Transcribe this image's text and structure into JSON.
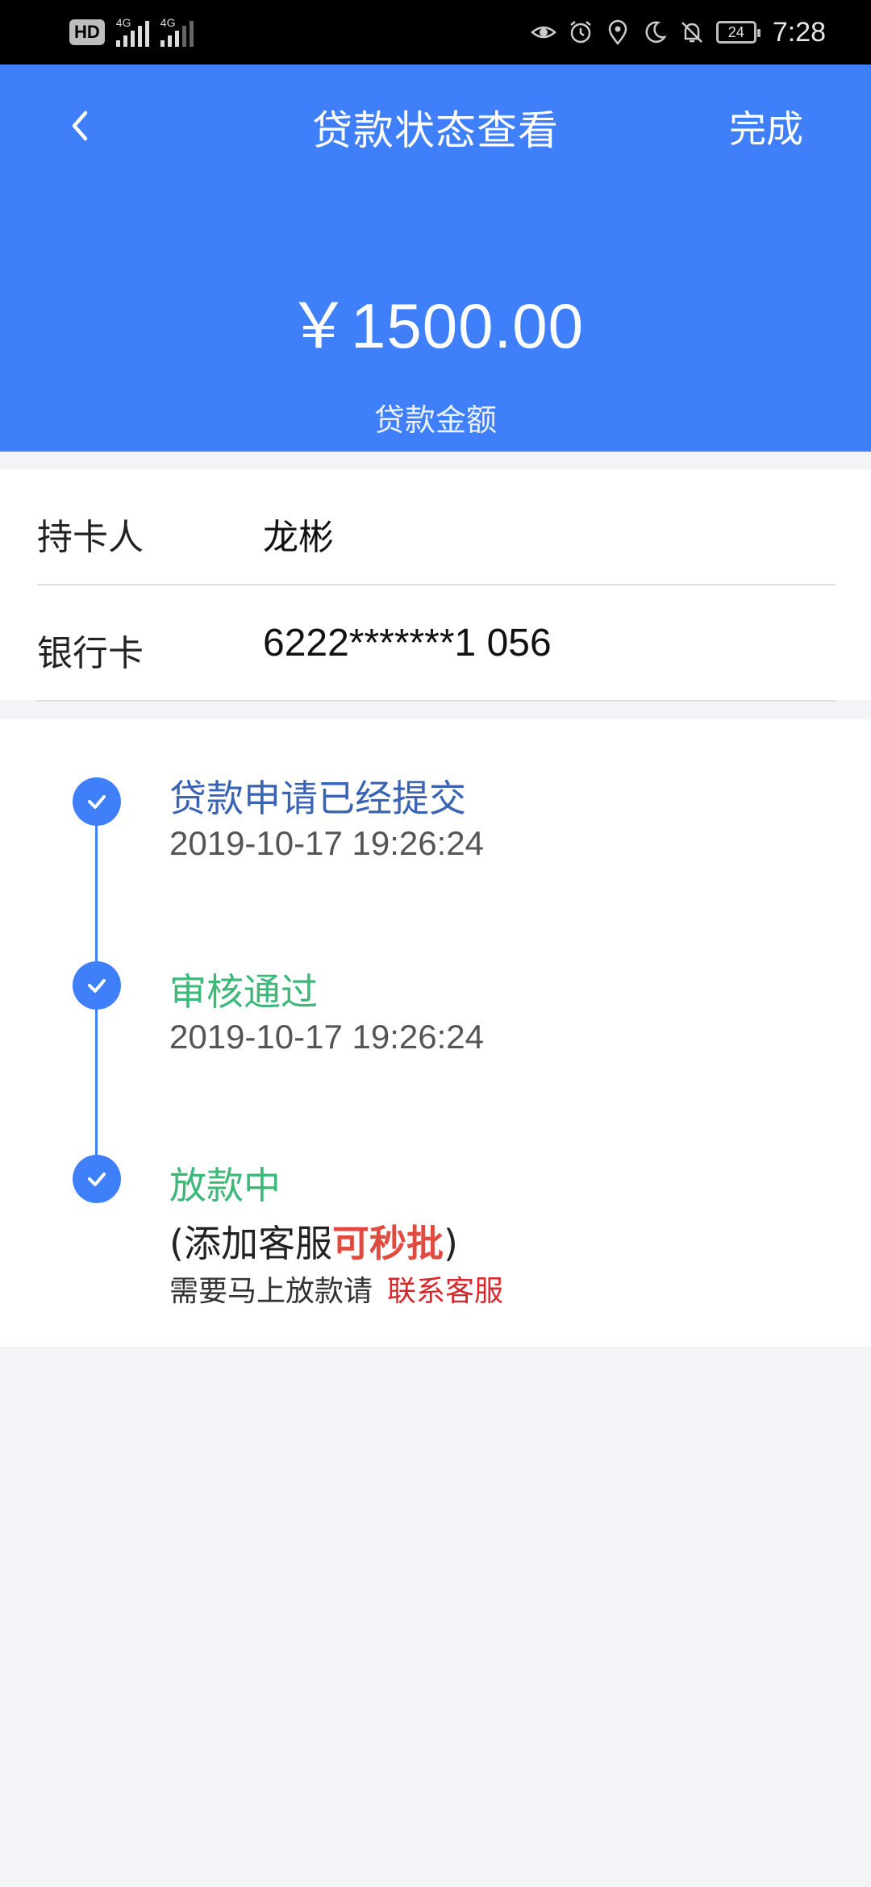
{
  "status_bar": {
    "hd_badge": "HD",
    "network_1": "4G",
    "network_2": "4G",
    "battery": "24",
    "time": "7:28",
    "icons": [
      "eye-icon",
      "alarm-icon",
      "location-icon",
      "moon-icon",
      "bell-off-icon"
    ]
  },
  "header": {
    "title": "贷款状态查看",
    "done_label": "完成",
    "amount": "￥1500.00",
    "amount_label": "贷款金额"
  },
  "info": {
    "cardholder_label": "持卡人",
    "cardholder_value": "龙彬",
    "bank_card_label": "银行卡",
    "bank_card_value": "6222*******1 056"
  },
  "timeline": [
    {
      "title": "贷款申请已经提交",
      "time": "2019-10-17 19:26:24",
      "color": "#3b63b5"
    },
    {
      "title": "审核通过",
      "time": "2019-10-17 19:26:24",
      "color": "#3cb878"
    },
    {
      "title": "放款中",
      "color": "#3cb878"
    }
  ],
  "note": {
    "prefix": "(添加客服",
    "highlight": "可秒批",
    "suffix": ")",
    "hint": "需要马上放款请",
    "link": "联系客服"
  },
  "colors": {
    "primary": "#3f80fa",
    "status_blue": "#3b63b5",
    "status_green": "#3cb878",
    "alert_red": "#d9262c"
  }
}
